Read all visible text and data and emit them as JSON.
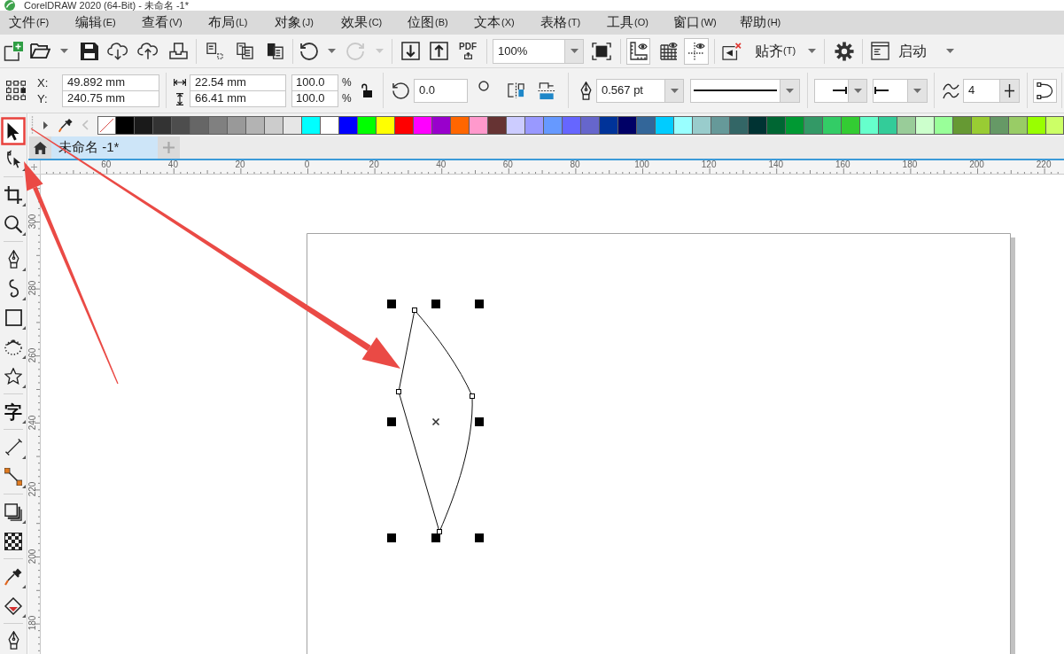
{
  "window": {
    "title": "CorelDRAW 2020 (64-Bit) - 未命名 -1*"
  },
  "menu": [
    {
      "label": "文件",
      "shortcut": "(F)"
    },
    {
      "label": "编辑",
      "shortcut": "(E)"
    },
    {
      "label": "查看",
      "shortcut": "(V)"
    },
    {
      "label": "布局",
      "shortcut": "(L)"
    },
    {
      "label": "对象",
      "shortcut": "(J)"
    },
    {
      "label": "效果",
      "shortcut": "(C)"
    },
    {
      "label": "位图",
      "shortcut": "(B)"
    },
    {
      "label": "文本",
      "shortcut": "(X)"
    },
    {
      "label": "表格",
      "shortcut": "(T)"
    },
    {
      "label": "工具",
      "shortcut": "(O)"
    },
    {
      "label": "窗口",
      "shortcut": "(W)"
    },
    {
      "label": "帮助",
      "shortcut": "(H)"
    }
  ],
  "toolbar": {
    "undo": {
      "disabled": false
    },
    "redo": {
      "disabled": true
    },
    "pdf": {
      "label": "PDF"
    },
    "zoom": {
      "value": "100%"
    },
    "rulers": {
      "on": true
    },
    "grid": {
      "on": false
    },
    "guidelines": {
      "on": true
    },
    "snap": {
      "label": "贴齐",
      "shortcut": "(T)"
    },
    "launch": {
      "label": "启动"
    }
  },
  "property_bar": {
    "position": [
      {
        "label": "X:",
        "value": "49.892 mm"
      },
      {
        "label": "Y:",
        "value": "240.75 mm"
      }
    ],
    "size": [
      {
        "value": "22.54 mm"
      },
      {
        "value": "66.41 mm"
      }
    ],
    "scale": [
      {
        "value": "100.0",
        "unit": "%"
      },
      {
        "value": "100.0",
        "unit": "%"
      }
    ],
    "lock_ratio": {
      "on": false
    },
    "rotation": {
      "value": "0.0"
    },
    "outline_width": {
      "value": "0.567 pt"
    },
    "smoothing": {
      "value": "4"
    }
  },
  "toolbox": {
    "groups": [
      {
        "tools": [
          {
            "kind": "pick",
            "selected": true,
            "flyout": false
          },
          {
            "kind": "shape",
            "selected": false,
            "flyout": true
          }
        ]
      },
      {
        "tools": [
          {
            "kind": "crop",
            "selected": false,
            "flyout": true
          },
          {
            "kind": "zoom",
            "selected": false,
            "flyout": true
          }
        ]
      },
      {
        "tools": [
          {
            "kind": "freehand",
            "selected": false,
            "flyout": true
          },
          {
            "kind": "artistic",
            "selected": false,
            "flyout": true
          },
          {
            "kind": "rectangle",
            "selected": false,
            "flyout": true
          },
          {
            "kind": "ellipse",
            "selected": false,
            "flyout": true
          },
          {
            "kind": "polygon",
            "selected": false,
            "flyout": true
          }
        ]
      },
      {
        "tools": [
          {
            "kind": "text",
            "glyph": "字",
            "selected": false,
            "flyout": true
          }
        ]
      },
      {
        "tools": [
          {
            "kind": "dimension",
            "selected": false,
            "flyout": true
          },
          {
            "kind": "connector",
            "selected": false,
            "flyout": true
          }
        ]
      },
      {
        "tools": [
          {
            "kind": "shadow",
            "selected": false,
            "flyout": true
          },
          {
            "kind": "transparency",
            "selected": false,
            "flyout": false
          }
        ]
      },
      {
        "tools": [
          {
            "kind": "eyedropper",
            "selected": false,
            "flyout": true
          },
          {
            "kind": "fill",
            "selected": false,
            "flyout": true
          }
        ]
      },
      {
        "tools": [
          {
            "kind": "outline",
            "selected": false,
            "flyout": false
          }
        ]
      }
    ]
  },
  "palette": [
    {
      "color": "#000000"
    },
    {
      "color": "#1a1a1a"
    },
    {
      "color": "#333333"
    },
    {
      "color": "#4d4d4d"
    },
    {
      "color": "#666666"
    },
    {
      "color": "#808080"
    },
    {
      "color": "#999999"
    },
    {
      "color": "#b3b3b3"
    },
    {
      "color": "#cccccc"
    },
    {
      "color": "#e6e6e6"
    },
    {
      "color": "#00ffff"
    },
    {
      "color": "#ffffff"
    },
    {
      "color": "#0000ff"
    },
    {
      "color": "#00ff00"
    },
    {
      "color": "#ffff00"
    },
    {
      "color": "#ff0000"
    },
    {
      "color": "#ff00ff"
    },
    {
      "color": "#9900cc"
    },
    {
      "color": "#ff6600"
    },
    {
      "color": "#ff99cc"
    },
    {
      "color": "#663333"
    },
    {
      "color": "#ccccff"
    },
    {
      "color": "#9999ff"
    },
    {
      "color": "#6699ff"
    },
    {
      "color": "#6666ff"
    },
    {
      "color": "#6666cc"
    },
    {
      "color": "#003399"
    },
    {
      "color": "#000066"
    },
    {
      "color": "#336699"
    },
    {
      "color": "#00ccff"
    },
    {
      "color": "#99ffff"
    },
    {
      "color": "#99cccc"
    },
    {
      "color": "#669999"
    },
    {
      "color": "#336666"
    },
    {
      "color": "#003333"
    },
    {
      "color": "#006633"
    },
    {
      "color": "#009933"
    },
    {
      "color": "#339966"
    },
    {
      "color": "#33cc66"
    },
    {
      "color": "#33cc33"
    },
    {
      "color": "#66ffcc"
    },
    {
      "color": "#33cc99"
    },
    {
      "color": "#99cc99"
    },
    {
      "color": "#ccffcc"
    },
    {
      "color": "#99ff99"
    },
    {
      "color": "#669933"
    },
    {
      "color": "#99cc33"
    },
    {
      "color": "#669966"
    },
    {
      "color": "#99cc66"
    },
    {
      "color": "#99ff00"
    },
    {
      "color": "#ccff66"
    }
  ],
  "document_tabs": [
    {
      "label": "未命名 -1*",
      "selected": true
    }
  ],
  "rulers": {
    "horizontal": [
      "60",
      "40",
      "20",
      "0",
      "20",
      "40",
      "60",
      "80",
      "100",
      "120",
      "140",
      "160",
      "180",
      "200",
      "220"
    ],
    "vertical": [
      "300",
      "280",
      "260",
      "240",
      "220",
      "200",
      "180"
    ]
  },
  "canvas": {
    "shape": {
      "selected": true
    }
  }
}
